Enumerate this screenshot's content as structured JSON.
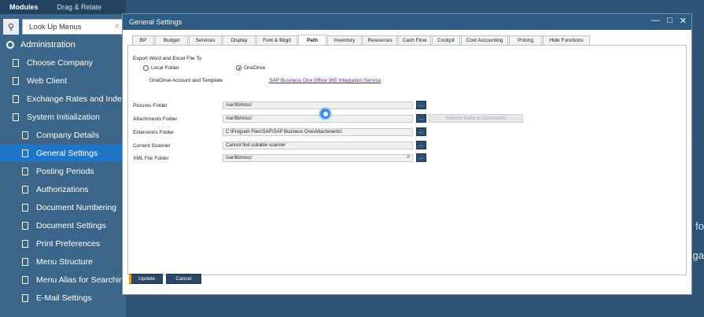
{
  "sidebar": {
    "tabs": [
      "Modules",
      "Drag & Relate"
    ],
    "search_placeholder": "Look Up Menus",
    "items": [
      {
        "label": "Administration",
        "level": 0,
        "icon": "gear-icon"
      },
      {
        "label": "Choose Company",
        "level": 1
      },
      {
        "label": "Web Client",
        "level": 1
      },
      {
        "label": "Exchange Rates and Indexes",
        "level": 1
      },
      {
        "label": "System Initialization",
        "level": 1
      },
      {
        "label": "Company Details",
        "level": 2
      },
      {
        "label": "General Settings",
        "level": 2,
        "selected": true
      },
      {
        "label": "Posting Periods",
        "level": 2
      },
      {
        "label": "Authorizations",
        "level": 2
      },
      {
        "label": "Document Numbering",
        "level": 2
      },
      {
        "label": "Document Settings",
        "level": 2
      },
      {
        "label": "Print Preferences",
        "level": 2
      },
      {
        "label": "Menu Structure",
        "level": 2
      },
      {
        "label": "Menu Alias for Searching",
        "level": 2
      },
      {
        "label": "E-Mail Settings",
        "level": 2
      }
    ]
  },
  "window": {
    "title": "General Settings",
    "controls": [
      "—",
      "□",
      "✕"
    ],
    "tabs": [
      "BP",
      "Budget",
      "Services",
      "Display",
      "Font & Bkgd",
      "Path",
      "Inventory",
      "Resources",
      "Cash Flow",
      "Cockpit",
      "Cost Accounting",
      "Pricing",
      "Hide Functions"
    ],
    "active_tab": "Path"
  },
  "path": {
    "export_heading": "Export Word and Excel File To",
    "option_local": "Local Folder",
    "option_onedrive": "OneDrive",
    "selected_option": "OneDrive",
    "onedrive_label": "OneDrive Account and Template",
    "onedrive_link": "SAP Business One Office 365 Integration Service",
    "pictures_label": "Pictures Folder",
    "pictures_value": "/var/lib/misc/",
    "attachments_label": "Attachments Folder",
    "attachments_value": "/var/lib/misc/",
    "extensions_label": "Extensions Folder",
    "extensions_value": "C:\\Program Files\\SAP\\SAP Business One\\Attachments\\",
    "scanner_label": "Current Scanner",
    "scanner_value": "Cannot find suitable scanner",
    "xml_label": "XML File Folder",
    "xml_value": "/var/lib/misc/",
    "browse_label": "...",
    "refresh_label": "Refresh Paths in Documents"
  },
  "footer": {
    "update_label": "Update",
    "cancel_label": "Cancel"
  },
  "background": {
    "text_1": "fo",
    "text_2": "ga"
  }
}
